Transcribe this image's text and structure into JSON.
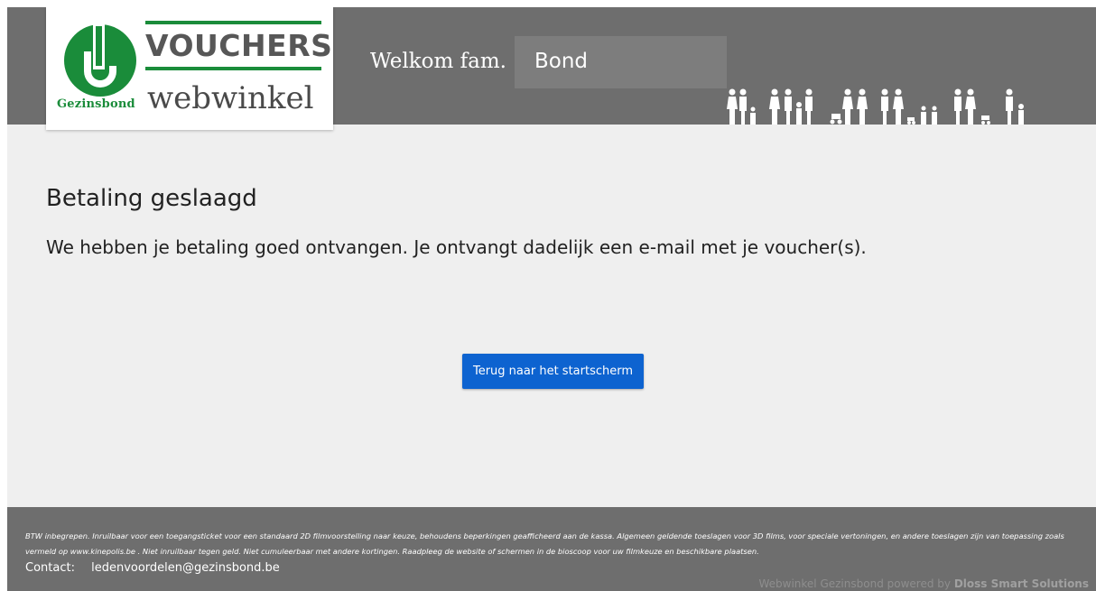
{
  "header": {
    "logo": {
      "brand": "Gezinsbond",
      "title": "VOUCHERS",
      "subtitle": "webwinkel",
      "green": "#1a8c3a"
    },
    "welcome_label": "Welkom fam.",
    "family_name": "Bond",
    "decoration_icon": "family-silhouettes-icon"
  },
  "main": {
    "title": "Betaling geslaagd",
    "message": "We hebben je betaling goed ontvangen. Je ontvangt dadelijk een e-mail met je voucher(s).",
    "back_button": "Terug naar het startscherm",
    "button_color": "#0d63d0"
  },
  "footer": {
    "disclaimer": "BTW inbegrepen. Inruilbaar voor een toegangsticket voor een standaard 2D filmvoorstelling naar keuze, behoudens beperkingen geafficheerd aan de kassa. Algemeen geldende toeslagen voor 3D films, voor speciale vertoningen, en andere toeslagen zijn van toepassing zoals vermeld op www.kinepolis.be . Niet inruilbaar tegen geld. Niet cumuleerbaar met andere kortingen. Raadpleeg de website of schermen in de bioscoop voor uw filmkeuze en beschikbare plaatsen.",
    "contact_label": "Contact:",
    "contact_email": "ledenvoordelen@gezinsbond.be",
    "powered_text": "Webwinkel Gezinsbond powered by",
    "powered_brand": "Dloss Smart Solutions"
  },
  "colors": {
    "header_bg": "#6e6e6e",
    "page_bg": "#efefef"
  }
}
